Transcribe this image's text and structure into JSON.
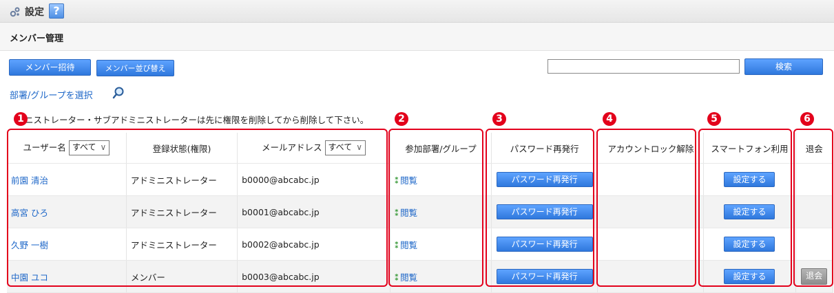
{
  "header": {
    "title": "設定",
    "help": "?"
  },
  "subheader": {
    "title": "メンバー管理"
  },
  "toolbar": {
    "invite_label": "メンバー招待",
    "sort_label": "メンバー並び替え",
    "search_value": "",
    "search_label": "検索"
  },
  "select_link": "部署/グループを選択",
  "notice": "ニストレーター・サブアドミニストレーターは先に権限を削除してから削除して下さい。",
  "badges": [
    "1",
    "2",
    "3",
    "4",
    "5",
    "6"
  ],
  "table": {
    "headers": {
      "username": "ユーザー名",
      "username_filter": "すべて",
      "status": "登録状態(権限)",
      "email": "メールアドレス",
      "email_filter": "すべて",
      "groups": "参加部署/グループ",
      "password": "パスワード再発行",
      "unlock": "アカウントロック解除",
      "smartphone": "スマートフォン利用",
      "withdraw": "退会"
    },
    "rows": [
      {
        "name": "前園 清治",
        "status": "アドミニストレーター",
        "email": "b0000@abcabc.jp",
        "groups": "閲覧",
        "password": "パスワード再発行",
        "smartphone": "設定する",
        "withdraw": ""
      },
      {
        "name": "高宮 ひろ",
        "status": "アドミニストレーター",
        "email": "b0001@abcabc.jp",
        "groups": "閲覧",
        "password": "パスワード再発行",
        "smartphone": "設定する",
        "withdraw": ""
      },
      {
        "name": "久野 一樹",
        "status": "アドミニストレーター",
        "email": "b0002@abcabc.jp",
        "groups": "閲覧",
        "password": "パスワード再発行",
        "smartphone": "設定する",
        "withdraw": ""
      },
      {
        "name": "中園 ユコ",
        "status": "メンバー",
        "email": "b0003@abcabc.jp",
        "groups": "閲覧",
        "password": "パスワード再発行",
        "smartphone": "設定する",
        "withdraw": "退会"
      }
    ]
  }
}
